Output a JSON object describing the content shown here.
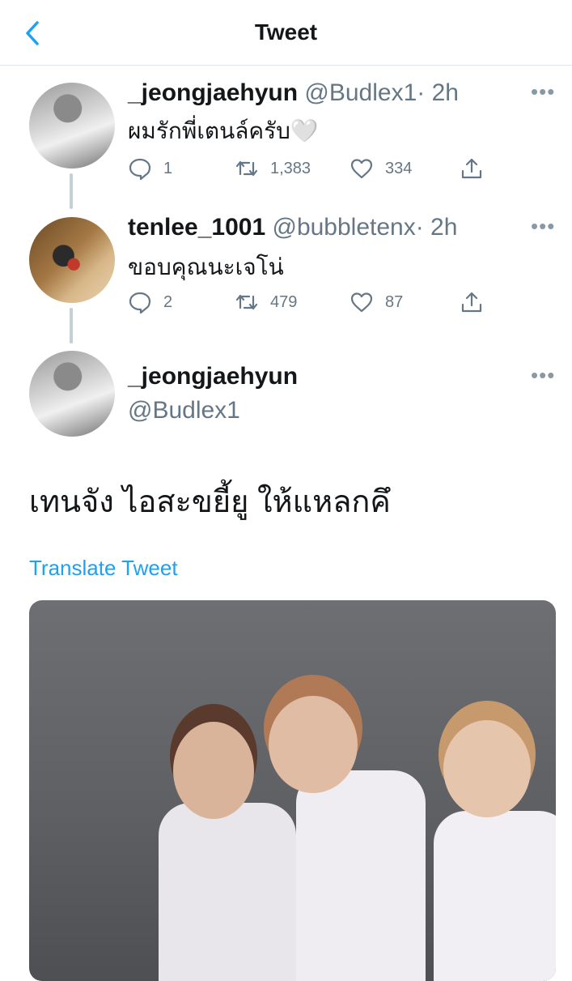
{
  "header": {
    "title": "Tweet"
  },
  "tweets": [
    {
      "name": "_jeongjaehyun",
      "handle": "@Budlex1",
      "time": "· 2h",
      "text": "ผมรักพี่เตนล์ครับ🤍",
      "replies": "1",
      "retweets": "1,383",
      "likes": "334"
    },
    {
      "name": "tenlee_1001",
      "handle": "@bubbletenx",
      "time": "· 2h",
      "text": "ขอบคุณนะเจโน่",
      "replies": "2",
      "retweets": "479",
      "likes": "87"
    }
  ],
  "main_tweet": {
    "name": "_jeongjaehyun",
    "handle": "@Budlex1",
    "text": "เทนจัง ไอสะขยี้ยู ให้แหลกคึ",
    "translate_label": "Translate Tweet"
  },
  "icons": {
    "back": "chevron-left-icon",
    "more": "more-icon",
    "reply": "reply-icon",
    "retweet": "retweet-icon",
    "like": "heart-icon",
    "share": "share-icon"
  },
  "colors": {
    "accent": "#1da1f2",
    "secondary_text": "#657786",
    "divider": "#e1e8ed"
  }
}
